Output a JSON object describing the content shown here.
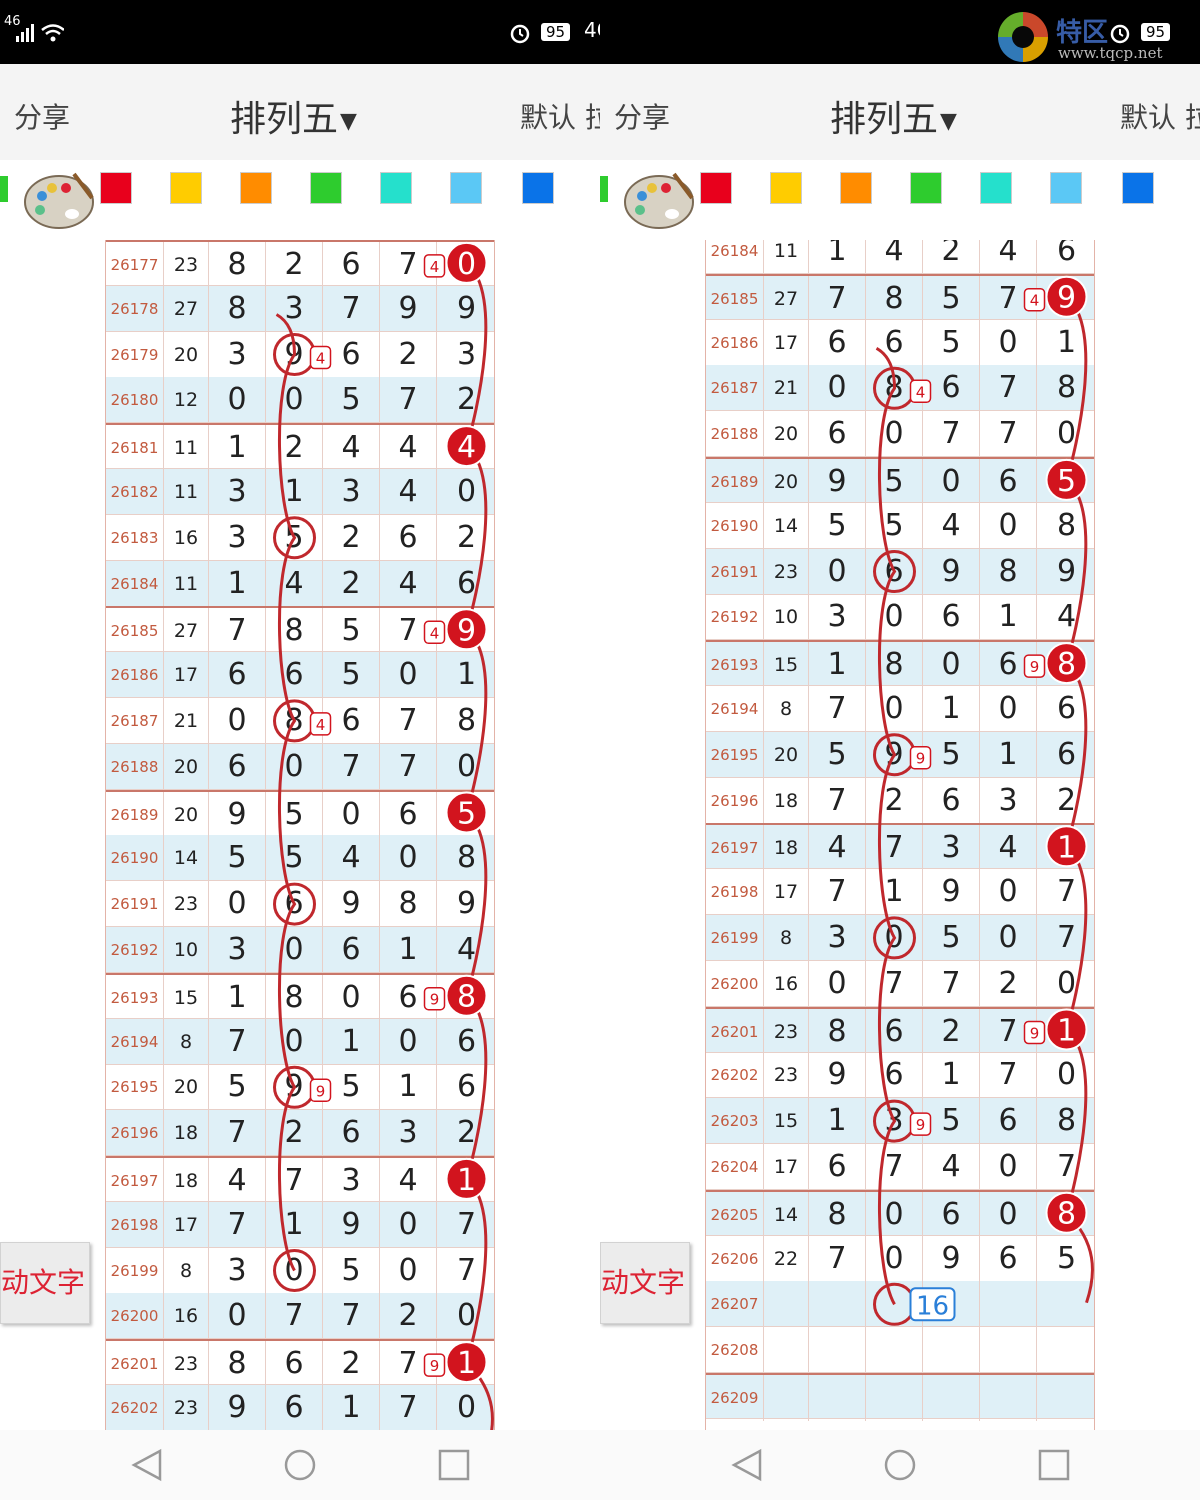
{
  "status": {
    "left_signal": "46",
    "battery": "95",
    "network": "4G"
  },
  "watermark": {
    "brand": "特区",
    "url": "www.tqcp.net"
  },
  "header": {
    "share_label": "分享",
    "title": "排列五",
    "default_label": "默认 拉"
  },
  "colors": [
    "#e8001c",
    "#ffcc00",
    "#ff8c00",
    "#2ecc2e",
    "#25e0cc",
    "#5bc8f5",
    "#0a73e8"
  ],
  "side_button_label": "动文字",
  "left_table": {
    "rows": [
      {
        "issue": "26177",
        "sum": "23",
        "d": [
          "8",
          "2",
          "6",
          "7",
          "0"
        ]
      },
      {
        "issue": "26178",
        "sum": "27",
        "d": [
          "8",
          "3",
          "7",
          "9",
          "9"
        ]
      },
      {
        "issue": "26179",
        "sum": "20",
        "d": [
          "3",
          "9",
          "6",
          "2",
          "3"
        ]
      },
      {
        "issue": "26180",
        "sum": "12",
        "d": [
          "0",
          "0",
          "5",
          "7",
          "2"
        ]
      },
      {
        "issue": "26181",
        "sum": "11",
        "d": [
          "1",
          "2",
          "4",
          "4",
          "4"
        ]
      },
      {
        "issue": "26182",
        "sum": "11",
        "d": [
          "3",
          "1",
          "3",
          "4",
          "0"
        ]
      },
      {
        "issue": "26183",
        "sum": "16",
        "d": [
          "3",
          "5",
          "2",
          "6",
          "2"
        ]
      },
      {
        "issue": "26184",
        "sum": "11",
        "d": [
          "1",
          "4",
          "2",
          "4",
          "6"
        ]
      },
      {
        "issue": "26185",
        "sum": "27",
        "d": [
          "7",
          "8",
          "5",
          "7",
          "9"
        ]
      },
      {
        "issue": "26186",
        "sum": "17",
        "d": [
          "6",
          "6",
          "5",
          "0",
          "1"
        ]
      },
      {
        "issue": "26187",
        "sum": "21",
        "d": [
          "0",
          "8",
          "6",
          "7",
          "8"
        ]
      },
      {
        "issue": "26188",
        "sum": "20",
        "d": [
          "6",
          "0",
          "7",
          "7",
          "0"
        ]
      },
      {
        "issue": "26189",
        "sum": "20",
        "d": [
          "9",
          "5",
          "0",
          "6",
          "5"
        ]
      },
      {
        "issue": "26190",
        "sum": "14",
        "d": [
          "5",
          "5",
          "4",
          "0",
          "8"
        ]
      },
      {
        "issue": "26191",
        "sum": "23",
        "d": [
          "0",
          "6",
          "9",
          "8",
          "9"
        ]
      },
      {
        "issue": "26192",
        "sum": "10",
        "d": [
          "3",
          "0",
          "6",
          "1",
          "4"
        ]
      },
      {
        "issue": "26193",
        "sum": "15",
        "d": [
          "1",
          "8",
          "0",
          "6",
          "8"
        ]
      },
      {
        "issue": "26194",
        "sum": "8",
        "d": [
          "7",
          "0",
          "1",
          "0",
          "6"
        ]
      },
      {
        "issue": "26195",
        "sum": "20",
        "d": [
          "5",
          "9",
          "5",
          "1",
          "6"
        ]
      },
      {
        "issue": "26196",
        "sum": "18",
        "d": [
          "7",
          "2",
          "6",
          "3",
          "2"
        ]
      },
      {
        "issue": "26197",
        "sum": "18",
        "d": [
          "4",
          "7",
          "3",
          "4",
          "1"
        ]
      },
      {
        "issue": "26198",
        "sum": "17",
        "d": [
          "7",
          "1",
          "9",
          "0",
          "7"
        ]
      },
      {
        "issue": "26199",
        "sum": "8",
        "d": [
          "3",
          "0",
          "5",
          "0",
          "7"
        ]
      },
      {
        "issue": "26200",
        "sum": "16",
        "d": [
          "0",
          "7",
          "7",
          "2",
          "0"
        ]
      },
      {
        "issue": "26201",
        "sum": "23",
        "d": [
          "8",
          "6",
          "2",
          "7",
          "1"
        ]
      },
      {
        "issue": "26202",
        "sum": "23",
        "d": [
          "9",
          "6",
          "1",
          "7",
          "0"
        ]
      }
    ],
    "filled_marks": [
      {
        "row": 0,
        "value": "0"
      },
      {
        "row": 4,
        "value": "4"
      },
      {
        "row": 8,
        "value": "9"
      },
      {
        "row": 12,
        "value": "5"
      },
      {
        "row": 16,
        "value": "8"
      },
      {
        "row": 20,
        "value": "1"
      },
      {
        "row": 24,
        "value": "1"
      }
    ],
    "open_marks": [
      {
        "row": 2,
        "col": 1
      },
      {
        "row": 6,
        "col": 1
      },
      {
        "row": 10,
        "col": 1
      },
      {
        "row": 14,
        "col": 1
      },
      {
        "row": 18,
        "col": 1
      },
      {
        "row": 22,
        "col": 1
      }
    ],
    "small_marks": [
      {
        "row": 0,
        "col": 3,
        "value": "4"
      },
      {
        "row": 2,
        "col": 1,
        "value": "4"
      },
      {
        "row": 8,
        "col": 3,
        "value": "4"
      },
      {
        "row": 10,
        "col": 1,
        "value": "4"
      },
      {
        "row": 16,
        "col": 3,
        "value": "9"
      },
      {
        "row": 18,
        "col": 1,
        "value": "9"
      },
      {
        "row": 24,
        "col": 3,
        "value": "9"
      }
    ]
  },
  "right_table": {
    "rows": [
      {
        "issue": "26184",
        "sum": "11",
        "d": [
          "1",
          "4",
          "2",
          "4",
          "6"
        ]
      },
      {
        "issue": "26185",
        "sum": "27",
        "d": [
          "7",
          "8",
          "5",
          "7",
          "9"
        ]
      },
      {
        "issue": "26186",
        "sum": "17",
        "d": [
          "6",
          "6",
          "5",
          "0",
          "1"
        ]
      },
      {
        "issue": "26187",
        "sum": "21",
        "d": [
          "0",
          "8",
          "6",
          "7",
          "8"
        ]
      },
      {
        "issue": "26188",
        "sum": "20",
        "d": [
          "6",
          "0",
          "7",
          "7",
          "0"
        ]
      },
      {
        "issue": "26189",
        "sum": "20",
        "d": [
          "9",
          "5",
          "0",
          "6",
          "5"
        ]
      },
      {
        "issue": "26190",
        "sum": "14",
        "d": [
          "5",
          "5",
          "4",
          "0",
          "8"
        ]
      },
      {
        "issue": "26191",
        "sum": "23",
        "d": [
          "0",
          "6",
          "9",
          "8",
          "9"
        ]
      },
      {
        "issue": "26192",
        "sum": "10",
        "d": [
          "3",
          "0",
          "6",
          "1",
          "4"
        ]
      },
      {
        "issue": "26193",
        "sum": "15",
        "d": [
          "1",
          "8",
          "0",
          "6",
          "8"
        ]
      },
      {
        "issue": "26194",
        "sum": "8",
        "d": [
          "7",
          "0",
          "1",
          "0",
          "6"
        ]
      },
      {
        "issue": "26195",
        "sum": "20",
        "d": [
          "5",
          "9",
          "5",
          "1",
          "6"
        ]
      },
      {
        "issue": "26196",
        "sum": "18",
        "d": [
          "7",
          "2",
          "6",
          "3",
          "2"
        ]
      },
      {
        "issue": "26197",
        "sum": "18",
        "d": [
          "4",
          "7",
          "3",
          "4",
          "1"
        ]
      },
      {
        "issue": "26198",
        "sum": "17",
        "d": [
          "7",
          "1",
          "9",
          "0",
          "7"
        ]
      },
      {
        "issue": "26199",
        "sum": "8",
        "d": [
          "3",
          "0",
          "5",
          "0",
          "7"
        ]
      },
      {
        "issue": "26200",
        "sum": "16",
        "d": [
          "0",
          "7",
          "7",
          "2",
          "0"
        ]
      },
      {
        "issue": "26201",
        "sum": "23",
        "d": [
          "8",
          "6",
          "2",
          "7",
          "1"
        ]
      },
      {
        "issue": "26202",
        "sum": "23",
        "d": [
          "9",
          "6",
          "1",
          "7",
          "0"
        ]
      },
      {
        "issue": "26203",
        "sum": "15",
        "d": [
          "1",
          "3",
          "5",
          "6",
          "8"
        ]
      },
      {
        "issue": "26204",
        "sum": "17",
        "d": [
          "6",
          "7",
          "4",
          "0",
          "7"
        ]
      },
      {
        "issue": "26205",
        "sum": "14",
        "d": [
          "8",
          "0",
          "6",
          "0",
          "8"
        ]
      },
      {
        "issue": "26206",
        "sum": "22",
        "d": [
          "7",
          "0",
          "9",
          "6",
          "5"
        ]
      },
      {
        "issue": "26207",
        "sum": "",
        "d": [
          "",
          "",
          "",
          "",
          ""
        ]
      },
      {
        "issue": "26208",
        "sum": "",
        "d": [
          "",
          "",
          "",
          "",
          ""
        ]
      },
      {
        "issue": "26209",
        "sum": "",
        "d": [
          "",
          "",
          "",
          "",
          ""
        ]
      }
    ],
    "filled_marks": [
      {
        "row": 1,
        "value": "9"
      },
      {
        "row": 5,
        "value": "5"
      },
      {
        "row": 9,
        "value": "8"
      },
      {
        "row": 13,
        "value": "1"
      },
      {
        "row": 17,
        "value": "1"
      },
      {
        "row": 21,
        "value": "8"
      }
    ],
    "open_marks": [
      {
        "row": 3,
        "col": 1
      },
      {
        "row": 7,
        "col": 1
      },
      {
        "row": 11,
        "col": 1
      },
      {
        "row": 15,
        "col": 1
      },
      {
        "row": 19,
        "col": 1
      },
      {
        "row": 23,
        "col": 1
      }
    ],
    "small_marks": [
      {
        "row": 1,
        "col": 3,
        "value": "4"
      },
      {
        "row": 3,
        "col": 1,
        "value": "4"
      },
      {
        "row": 9,
        "col": 3,
        "value": "9"
      },
      {
        "row": 11,
        "col": 1,
        "value": "9"
      },
      {
        "row": 17,
        "col": 3,
        "value": "9"
      },
      {
        "row": 19,
        "col": 1,
        "value": "9"
      }
    ],
    "prediction": {
      "row": 23,
      "col": 1,
      "value": "16"
    }
  }
}
